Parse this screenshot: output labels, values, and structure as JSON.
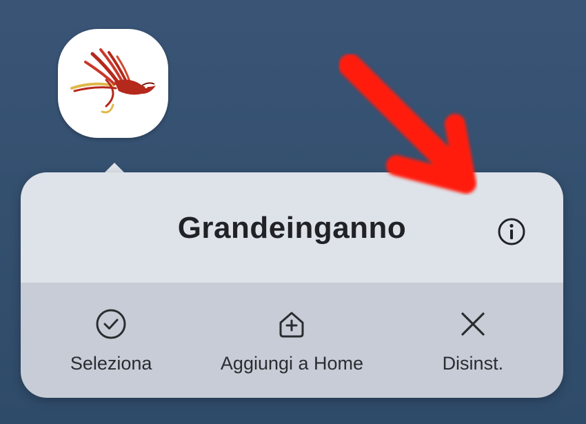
{
  "app": {
    "name": "Grandeinganno",
    "icon": "bird-feather-logo-icon"
  },
  "popup": {
    "info_icon": "info-icon",
    "actions": [
      {
        "label": "Seleziona",
        "icon": "check-circle-icon"
      },
      {
        "label": "Aggiungi a Home",
        "icon": "add-to-home-icon"
      },
      {
        "label": "Disinst.",
        "icon": "close-icon"
      }
    ]
  },
  "annotation": {
    "type": "red-arrow",
    "color": "#ff1a0e",
    "points_to": "info-button"
  },
  "colors": {
    "wallpaper": "#34506f",
    "popup_header": "#dee2e9",
    "popup_actions": "#c7ccd6"
  }
}
